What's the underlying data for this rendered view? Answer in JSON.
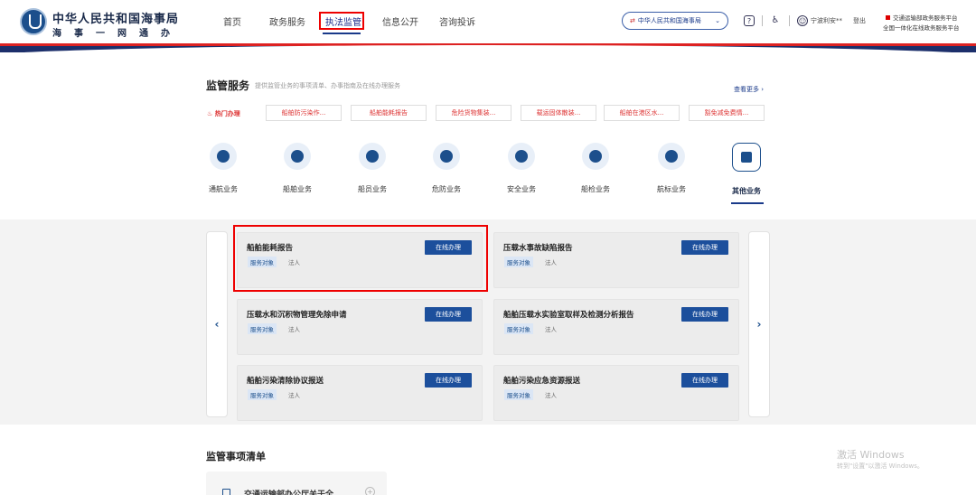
{
  "header": {
    "brand_title": "中华人民共和国海事局",
    "brand_sub": "海事一网通办",
    "nav": [
      "首页",
      "政务服务",
      "执法监管",
      "信息公开",
      "咨询投诉"
    ],
    "active_nav": 2,
    "maritime_label": "中华人民共和国海事局",
    "help_icon": "?",
    "user_name": "宁波利安**",
    "logout": "登出",
    "platform_line1": "交通运输部政务服务平台",
    "platform_line2": "全国一体化在线政务服务平台"
  },
  "service": {
    "title": "监管服务",
    "desc": "提供监管业务的事项清单、办事指南及在线办理服务",
    "more": "查看更多",
    "hot_label": "热门办理",
    "hot_items": [
      "船舶防污染作...",
      "船舶能耗报告",
      "危险货物集装...",
      "载运固体散装...",
      "船舶在港区水...",
      "豁免减免费情..."
    ],
    "categories": [
      "通航业务",
      "船舶业务",
      "船员业务",
      "危防业务",
      "安全业务",
      "船检业务",
      "航标业务",
      "其他业务"
    ],
    "active_category": 7
  },
  "cards": [
    {
      "title": "船舶能耗报告",
      "tag": "服务对象",
      "object": "法人",
      "button": "在线办理"
    },
    {
      "title": "压载水事故缺陷报告",
      "tag": "服务对象",
      "object": "法人",
      "button": "在线办理"
    },
    {
      "title": "压载水和沉积物管理免除申请",
      "tag": "服务对象",
      "object": "法人",
      "button": "在线办理"
    },
    {
      "title": "船舶压载水实验室取样及检测分析报告",
      "tag": "服务对象",
      "object": "法人",
      "button": "在线办理"
    },
    {
      "title": "船舶污染清除协议报送",
      "tag": "服务对象",
      "object": "法人",
      "button": "在线办理"
    },
    {
      "title": "船舶污染应急资源报送",
      "tag": "服务对象",
      "object": "法人",
      "button": "在线办理"
    }
  ],
  "nav_arrows": {
    "prev": "‹",
    "next": "›"
  },
  "list": {
    "title": "监管事项清单",
    "first_item": "交通运输部办公厅关于全",
    "plus": "+"
  },
  "watermark": {
    "line1": "激活 Windows",
    "line2": "转到\"设置\"以激活 Windows。"
  },
  "colors": {
    "primary": "#1c4f9c",
    "accent_red": "#dd2222",
    "navy": "#1c2f6b"
  }
}
